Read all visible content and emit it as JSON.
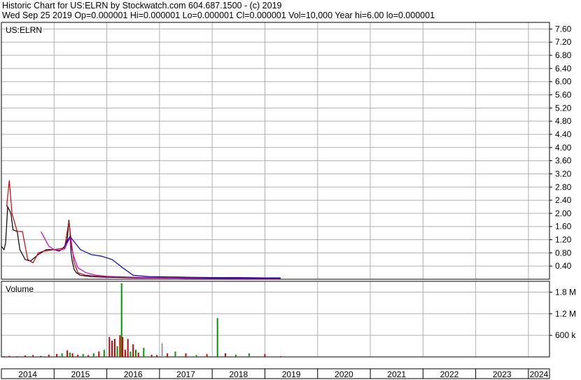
{
  "header": {
    "line1": "Historic Chart for US:ELRN by Stockwatch.com 604.687.1500 - (c) 2019",
    "line2": "Wed Sep 25 2019   Op=0.000001   Hi=0.000001   Lo=0.000001   Cl=0.000001   Vol=10,000   Year hi=6.00   lo=0.000001"
  },
  "chart_data": [
    {
      "type": "line",
      "title": "US:ELRN",
      "ylim": [
        0,
        7.8
      ],
      "y_ticks": [
        "7.60",
        "7.20",
        "6.80",
        "6.40",
        "6.00",
        "5.60",
        "5.20",
        "4.80",
        "4.40",
        "4.00",
        "3.60",
        "3.20",
        "2.80",
        "2.40",
        "2.00",
        "1.60",
        "1.20",
        "0.80",
        "0.40"
      ],
      "y_tick_values": [
        7.6,
        7.2,
        6.8,
        6.4,
        6.0,
        5.6,
        5.2,
        4.8,
        4.4,
        4.0,
        3.6,
        3.2,
        2.8,
        2.4,
        2.0,
        1.6,
        1.2,
        0.8,
        0.4
      ],
      "xlim": [
        2014.0,
        2024.4
      ],
      "grid": true,
      "series": [
        {
          "color": "#000000",
          "x": [
            2014.0,
            2014.05,
            2014.08,
            2014.12,
            2014.18,
            2014.22,
            2014.3,
            2014.35,
            2014.45,
            2014.55,
            2014.7,
            2014.85,
            2015.0,
            2015.1,
            2015.2,
            2015.25,
            2015.28,
            2015.3,
            2015.32,
            2015.35,
            2015.38,
            2015.42,
            2015.5,
            2015.6,
            2015.7,
            2015.8,
            2016.0,
            2016.3,
            2016.6,
            2017.0,
            2017.5,
            2018.0,
            2018.5,
            2019.0,
            2019.3
          ],
          "y": [
            1.0,
            0.9,
            1.1,
            2.2,
            2.0,
            1.5,
            1.45,
            0.9,
            0.6,
            0.55,
            0.75,
            0.9,
            0.9,
            0.85,
            1.0,
            1.2,
            1.8,
            1.5,
            0.8,
            0.5,
            0.3,
            0.2,
            0.12,
            0.1,
            0.08,
            0.07,
            0.06,
            0.05,
            0.04,
            0.04,
            0.03,
            0.03,
            0.03,
            0.02,
            0.02
          ]
        },
        {
          "color": "#cc0000",
          "x": [
            2014.1,
            2014.15,
            2014.2,
            2014.3,
            2014.4,
            2014.5,
            2014.6,
            2014.7,
            2014.8,
            2015.0,
            2015.2,
            2015.28,
            2015.33,
            2015.38,
            2015.45,
            2015.6,
            2015.9,
            2016.2,
            2016.6,
            2017.0,
            2018.0,
            2019.0,
            2019.3
          ],
          "y": [
            2.2,
            3.0,
            2.0,
            1.45,
            1.45,
            0.6,
            0.5,
            0.8,
            0.85,
            0.9,
            0.95,
            1.75,
            1.1,
            0.5,
            0.2,
            0.12,
            0.09,
            0.07,
            0.05,
            0.04,
            0.03,
            0.02,
            0.02
          ]
        },
        {
          "color": "#cc00cc",
          "x": [
            2014.75,
            2014.9,
            2015.0,
            2015.1,
            2015.2,
            2015.25,
            2015.3,
            2015.35,
            2015.45,
            2015.6,
            2015.8,
            2016.0,
            2016.3,
            2016.6,
            2017.0,
            2017.5,
            2018.0,
            2018.6,
            2019.3
          ],
          "y": [
            1.45,
            1.0,
            0.9,
            0.88,
            0.92,
            1.1,
            1.25,
            0.8,
            0.35,
            0.2,
            0.12,
            0.09,
            0.07,
            0.06,
            0.05,
            0.04,
            0.04,
            0.03,
            0.03
          ]
        },
        {
          "color": "#0000cc",
          "x": [
            2015.2,
            2015.3,
            2015.4,
            2015.5,
            2015.7,
            2015.9,
            2016.1,
            2016.3,
            2016.5,
            2016.8,
            2017.2,
            2017.6,
            2018.0,
            2018.5,
            2019.0,
            2019.3
          ],
          "y": [
            1.0,
            1.3,
            1.1,
            0.9,
            0.75,
            0.7,
            0.6,
            0.35,
            0.12,
            0.08,
            0.07,
            0.06,
            0.05,
            0.05,
            0.04,
            0.04
          ]
        }
      ]
    },
    {
      "type": "bar",
      "title": "Volume",
      "ylim": [
        0,
        2.1
      ],
      "unit_note": "millions of shares",
      "y_ticks": [
        "1.8 M",
        "1.2 M",
        "600 k"
      ],
      "y_tick_values": [
        1.8,
        1.2,
        0.6
      ],
      "x": [
        2014.05,
        2014.15,
        2014.3,
        2014.45,
        2014.6,
        2014.75,
        2014.9,
        2015.05,
        2015.15,
        2015.25,
        2015.3,
        2015.35,
        2015.45,
        2015.55,
        2015.65,
        2015.75,
        2015.85,
        2015.95,
        2016.05,
        2016.1,
        2016.15,
        2016.2,
        2016.25,
        2016.28,
        2016.3,
        2016.35,
        2016.4,
        2016.45,
        2016.5,
        2016.55,
        2016.6,
        2016.7,
        2016.85,
        2016.95,
        2017.05,
        2017.15,
        2017.3,
        2017.5,
        2017.7,
        2017.9,
        2018.1,
        2018.25,
        2018.45,
        2018.7,
        2019.0,
        2019.3
      ],
      "values": [
        0.02,
        0.03,
        0.02,
        0.04,
        0.05,
        0.03,
        0.06,
        0.08,
        0.1,
        0.18,
        0.12,
        0.1,
        0.06,
        0.08,
        0.05,
        0.1,
        0.15,
        0.2,
        0.55,
        0.45,
        0.5,
        0.3,
        0.6,
        2.05,
        0.55,
        0.2,
        0.5,
        0.15,
        0.35,
        0.2,
        0.12,
        0.25,
        0.06,
        0.05,
        0.38,
        0.1,
        0.15,
        0.1,
        0.05,
        0.08,
        1.08,
        0.1,
        0.06,
        0.1,
        0.08,
        0.02
      ],
      "colors": [
        "#cc0000",
        "#cc0000",
        "#cc0000",
        "#cc0000",
        "#cc0000",
        "#cc0000",
        "#cc0000",
        "#cc0000",
        "#009900",
        "#cc0000",
        "#009900",
        "#cc0000",
        "#cc0000",
        "#009900",
        "#cc0000",
        "#009900",
        "#cc0000",
        "#009900",
        "#cc0000",
        "#cc0000",
        "#cc0000",
        "#009900",
        "#cc0000",
        "#009900",
        "#cc0000",
        "#cc0000",
        "#cc0000",
        "#009900",
        "#cc0000",
        "#009900",
        "#cc0000",
        "#009900",
        "#cc0000",
        "#cc0000",
        "#999999",
        "#cc0000",
        "#009900",
        "#cc0000",
        "#009900",
        "#cc0000",
        "#009900",
        "#cc0000",
        "#009900",
        "#009900",
        "#cc0000",
        "#cc0000"
      ]
    }
  ],
  "x_axis_labels": [
    "2014",
    "2015",
    "2016",
    "2017",
    "2018",
    "2019",
    "2020",
    "2021",
    "2022",
    "2023",
    "2024"
  ]
}
